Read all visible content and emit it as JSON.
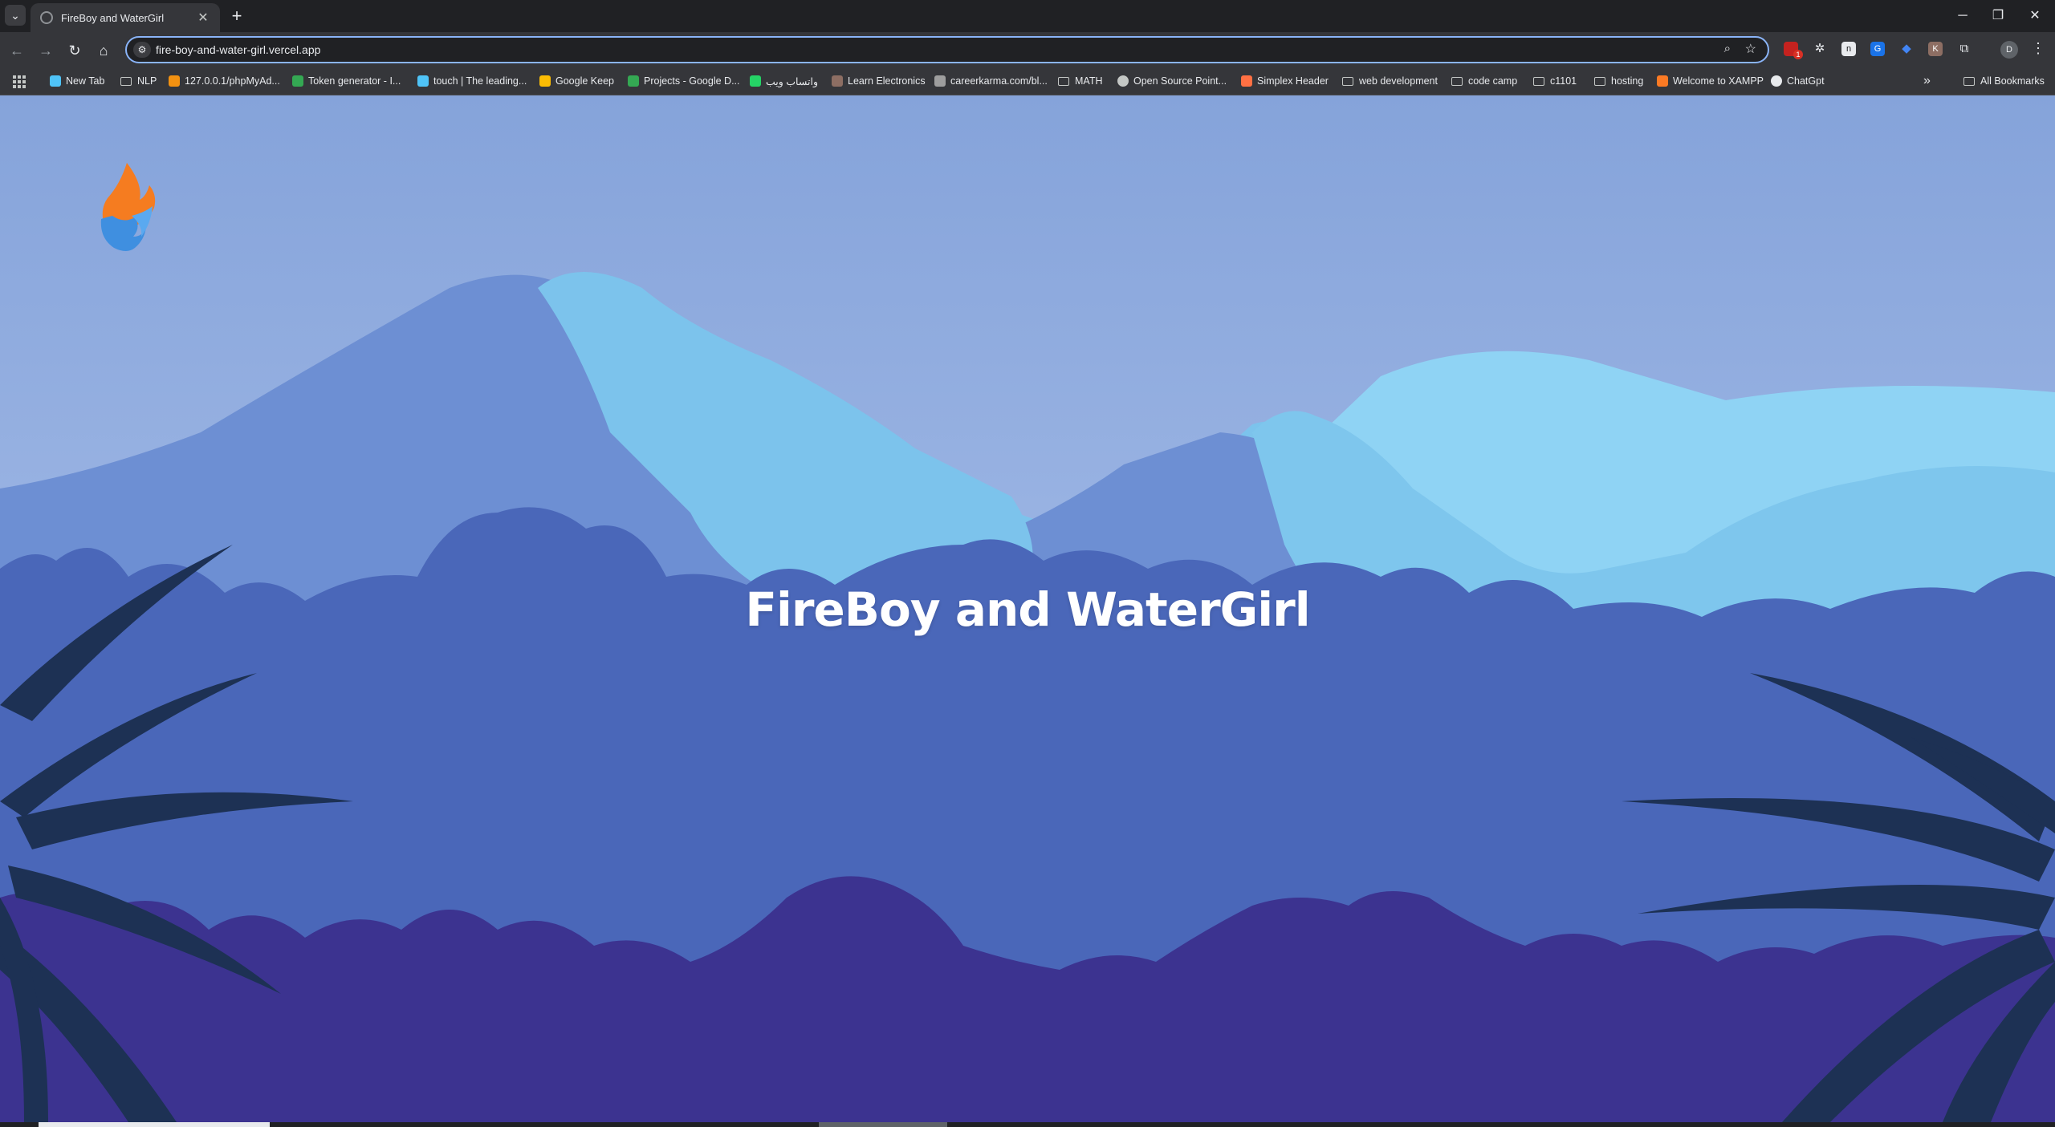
{
  "browser": {
    "tab_title": "FireBoy and WaterGirl",
    "url": "fire-boy-and-water-girl.vercel.app",
    "profile_initial": "D",
    "extension_badge": "1",
    "window_controls": {
      "minimize": "─",
      "restore": "❐",
      "close": "✕"
    }
  },
  "bookmarks": [
    {
      "label": "New Tab",
      "icon": "new-tab-icon",
      "color": "#4fc3f7"
    },
    {
      "label": "NLP",
      "icon": "folder-icon"
    },
    {
      "label": "127.0.0.1/phpMyAd...",
      "icon": "phpmyadmin-icon",
      "color": "#f29111"
    },
    {
      "label": "Token generator - I...",
      "icon": "token-icon",
      "color": "#34a853"
    },
    {
      "label": "touch | The leading...",
      "icon": "touch-icon",
      "color": "#4fc3f7"
    },
    {
      "label": "Google Keep",
      "icon": "keep-icon",
      "color": "#fbbc04"
    },
    {
      "label": "Projects - Google D...",
      "icon": "drive-icon",
      "color": "#34a853"
    },
    {
      "label": "واتساب ويب",
      "icon": "whatsapp-icon",
      "color": "#25d366"
    },
    {
      "label": "Learn Electronics",
      "icon": "electronics-icon",
      "color": "#8d6e63"
    },
    {
      "label": "careerkarma.com/bl...",
      "icon": "careerkarma-icon",
      "color": "#9e9e9e"
    },
    {
      "label": "MATH",
      "icon": "folder-icon"
    },
    {
      "label": "Open Source Point...",
      "icon": "link-icon",
      "color": "#c4c7c5"
    },
    {
      "label": "Simplex Header",
      "icon": "simplex-icon",
      "color": "#ff7043"
    },
    {
      "label": "web development",
      "icon": "folder-icon"
    },
    {
      "label": "code camp",
      "icon": "folder-icon"
    },
    {
      "label": "c1101",
      "icon": "folder-icon"
    },
    {
      "label": "hosting",
      "icon": "folder-icon"
    },
    {
      "label": "Welcome to XAMPP",
      "icon": "xampp-icon",
      "color": "#fb7a24"
    },
    {
      "label": "ChatGpt",
      "icon": "chatgpt-icon",
      "color": "#e8eaed"
    }
  ],
  "bookmarks_overflow": "»",
  "all_bookmarks": "All Bookmarks",
  "page": {
    "title": "FireBoy and WaterGirl",
    "colors": {
      "sky_top": "#8aa6dc",
      "sky_bottom": "#a9bfe8",
      "mountain_dark": "#6d8fd3",
      "mountain_light": "#7cc3ec",
      "mountain_pale": "#8fd3f4",
      "jungle_mid": "#4a67b9",
      "jungle_front": "#3c3390",
      "leaf_dark": "#1d3154",
      "fire_orange": "#f57c20",
      "water_blue": "#3f8fe0"
    }
  }
}
